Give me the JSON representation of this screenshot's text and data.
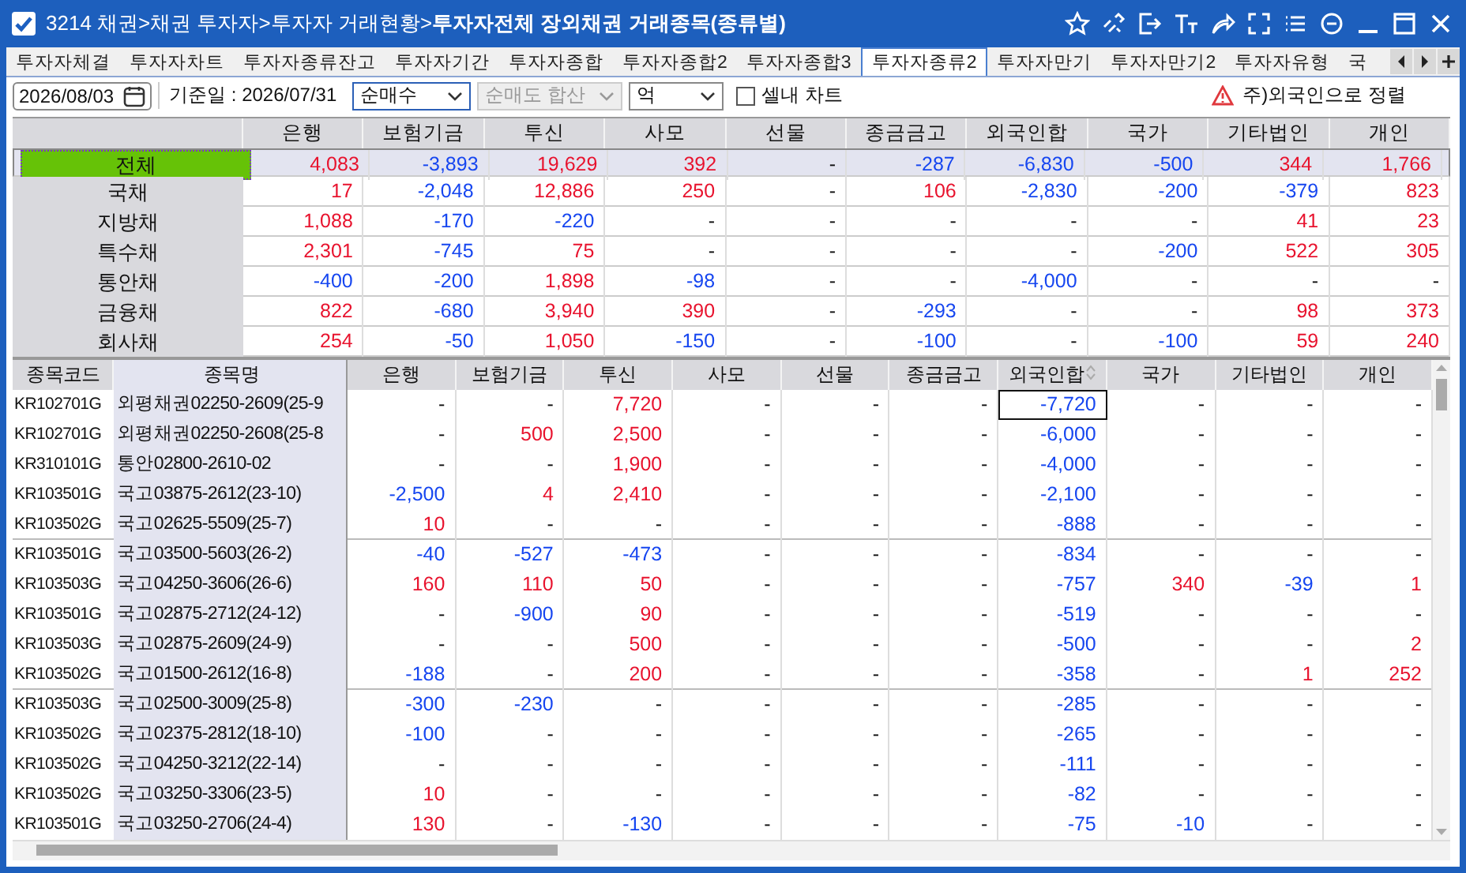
{
  "window": {
    "title": "3214 채권>채권 투자자>투자자 거래현황>**투자자전체 장외채권 거래종목(종류별)**"
  },
  "tabs": [
    {
      "label": "투자자체결",
      "selected": false
    },
    {
      "label": "투자자차트",
      "selected": false
    },
    {
      "label": "투자자종류잔고",
      "selected": false
    },
    {
      "label": "투자자기간",
      "selected": false
    },
    {
      "label": "투자자종합",
      "selected": false
    },
    {
      "label": "투자자종합2",
      "selected": false
    },
    {
      "label": "투자자종합3",
      "selected": false
    },
    {
      "label": "투자자종류2",
      "selected": true
    },
    {
      "label": "투자자만기",
      "selected": false
    },
    {
      "label": "투자자만기2",
      "selected": false
    },
    {
      "label": "투자자유형",
      "selected": false
    },
    {
      "label": "국",
      "selected": false
    }
  ],
  "toolbar": {
    "date": "2026/08/03",
    "base_date": "기준일 : 2026/07/31",
    "selects": [
      {
        "value": "순매수",
        "disabled": false
      },
      {
        "value": "순매도 합산",
        "disabled": true
      },
      {
        "value": "억",
        "disabled": false
      }
    ],
    "chart_checkbox": {
      "label": "셀내 차트",
      "checked": false
    },
    "note": "주)외국인으로 정렬"
  },
  "summary_table": {
    "columns": [
      "은행",
      "보험기금",
      "투신",
      "사모",
      "선물",
      "종금금고",
      "외국인합",
      "국가",
      "기타법인",
      "개인"
    ],
    "rows": [
      {
        "label": "전체",
        "selected": true,
        "cells": [
          "4,083",
          "-3,893",
          "19,629",
          "392",
          "-",
          "-287",
          "-6,830",
          "-500",
          "344",
          "1,766"
        ]
      },
      {
        "label": "국채",
        "selected": false,
        "cells": [
          "17",
          "-2,048",
          "12,886",
          "250",
          "-",
          "106",
          "-2,830",
          "-200",
          "-379",
          "823"
        ]
      },
      {
        "label": "지방채",
        "selected": false,
        "cells": [
          "1,088",
          "-170",
          "-220",
          "-",
          "-",
          "-",
          "-",
          "-",
          "41",
          "23"
        ]
      },
      {
        "label": "특수채",
        "selected": false,
        "cells": [
          "2,301",
          "-745",
          "75",
          "-",
          "-",
          "-",
          "-",
          "-200",
          "522",
          "305"
        ]
      },
      {
        "label": "통안채",
        "selected": false,
        "cells": [
          "-400",
          "-200",
          "1,898",
          "-98",
          "-",
          "-",
          "-4,000",
          "-",
          "-",
          "-"
        ]
      },
      {
        "label": "금융채",
        "selected": false,
        "cells": [
          "822",
          "-680",
          "3,940",
          "390",
          "-",
          "-293",
          "-",
          "-",
          "98",
          "373"
        ]
      },
      {
        "label": "회사채",
        "selected": false,
        "cells": [
          "254",
          "-50",
          "1,050",
          "-150",
          "-",
          "-100",
          "-",
          "-100",
          "59",
          "240"
        ]
      }
    ]
  },
  "detail_table": {
    "code_column": "종목코드",
    "name_column": "종목명",
    "columns": [
      {
        "label": "은행",
        "sorted": false
      },
      {
        "label": "보험기금",
        "sorted": false
      },
      {
        "label": "투신",
        "sorted": false
      },
      {
        "label": "사모",
        "sorted": false
      },
      {
        "label": "선물",
        "sorted": false
      },
      {
        "label": "종금금고",
        "sorted": false
      },
      {
        "label": "외국인합",
        "sorted": true
      },
      {
        "label": "국가",
        "sorted": false
      },
      {
        "label": "기타법인",
        "sorted": false
      },
      {
        "label": "개인",
        "sorted": false
      }
    ],
    "rows": [
      {
        "code": "KR102701G",
        "name": "외평채권02250-2609(25-9",
        "focused": true,
        "cells": [
          "-",
          "-",
          "7,720",
          "-",
          "-",
          "-",
          "-7,720",
          "-",
          "-",
          "-"
        ]
      },
      {
        "code": "KR102701G",
        "name": "외평채권02250-2608(25-8",
        "focused": false,
        "cells": [
          "-",
          "500",
          "2,500",
          "-",
          "-",
          "-",
          "-6,000",
          "-",
          "-",
          "-"
        ]
      },
      {
        "code": "KR310101G",
        "name": "통안02800-2610-02",
        "focused": false,
        "cells": [
          "-",
          "-",
          "1,900",
          "-",
          "-",
          "-",
          "-4,000",
          "-",
          "-",
          "-"
        ]
      },
      {
        "code": "KR103501G",
        "name": "국고03875-2612(23-10)",
        "focused": false,
        "cells": [
          "-2,500",
          "4",
          "2,410",
          "-",
          "-",
          "-",
          "-2,100",
          "-",
          "-",
          "-"
        ]
      },
      {
        "code": "KR103502G",
        "name": "국고02625-5509(25-7)",
        "focused": false,
        "cells": [
          "10",
          "-",
          "-",
          "-",
          "-",
          "-",
          "-888",
          "-",
          "-",
          "-"
        ]
      },
      {
        "code": "KR103501G",
        "name": "국고03500-5603(26-2)",
        "focused": false,
        "cells": [
          "-40",
          "-527",
          "-473",
          "-",
          "-",
          "-",
          "-834",
          "-",
          "-",
          "-"
        ]
      },
      {
        "code": "KR103503G",
        "name": "국고04250-3606(26-6)",
        "focused": false,
        "cells": [
          "160",
          "110",
          "50",
          "-",
          "-",
          "-",
          "-757",
          "340",
          "-39",
          "1"
        ]
      },
      {
        "code": "KR103501G",
        "name": "국고02875-2712(24-12)",
        "focused": false,
        "cells": [
          "-",
          "-900",
          "90",
          "-",
          "-",
          "-",
          "-519",
          "-",
          "-",
          "-"
        ]
      },
      {
        "code": "KR103503G",
        "name": "국고02875-2609(24-9)",
        "focused": false,
        "cells": [
          "-",
          "-",
          "500",
          "-",
          "-",
          "-",
          "-500",
          "-",
          "-",
          "2"
        ]
      },
      {
        "code": "KR103502G",
        "name": "국고01500-2612(16-8)",
        "focused": false,
        "cells": [
          "-188",
          "-",
          "200",
          "-",
          "-",
          "-",
          "-358",
          "-",
          "1",
          "252"
        ]
      },
      {
        "code": "KR103503G",
        "name": "국고02500-3009(25-8)",
        "focused": false,
        "cells": [
          "-300",
          "-230",
          "-",
          "-",
          "-",
          "-",
          "-285",
          "-",
          "-",
          "-"
        ]
      },
      {
        "code": "KR103502G",
        "name": "국고02375-2812(18-10)",
        "focused": false,
        "cells": [
          "-100",
          "-",
          "-",
          "-",
          "-",
          "-",
          "-265",
          "-",
          "-",
          "-"
        ]
      },
      {
        "code": "KR103502G",
        "name": "국고04250-3212(22-14)",
        "focused": false,
        "cells": [
          "-",
          "-",
          "-",
          "-",
          "-",
          "-",
          "-111",
          "-",
          "-",
          "-"
        ]
      },
      {
        "code": "KR103502G",
        "name": "국고03250-3306(23-5)",
        "focused": false,
        "cells": [
          "10",
          "-",
          "-",
          "-",
          "-",
          "-",
          "-82",
          "-",
          "-",
          "-"
        ]
      },
      {
        "code": "KR103501G",
        "name": "국고03250-2706(24-4)",
        "focused": false,
        "cells": [
          "130",
          "-",
          "-130",
          "-",
          "-",
          "-",
          "-75",
          "-10",
          "-",
          "-"
        ]
      }
    ]
  }
}
